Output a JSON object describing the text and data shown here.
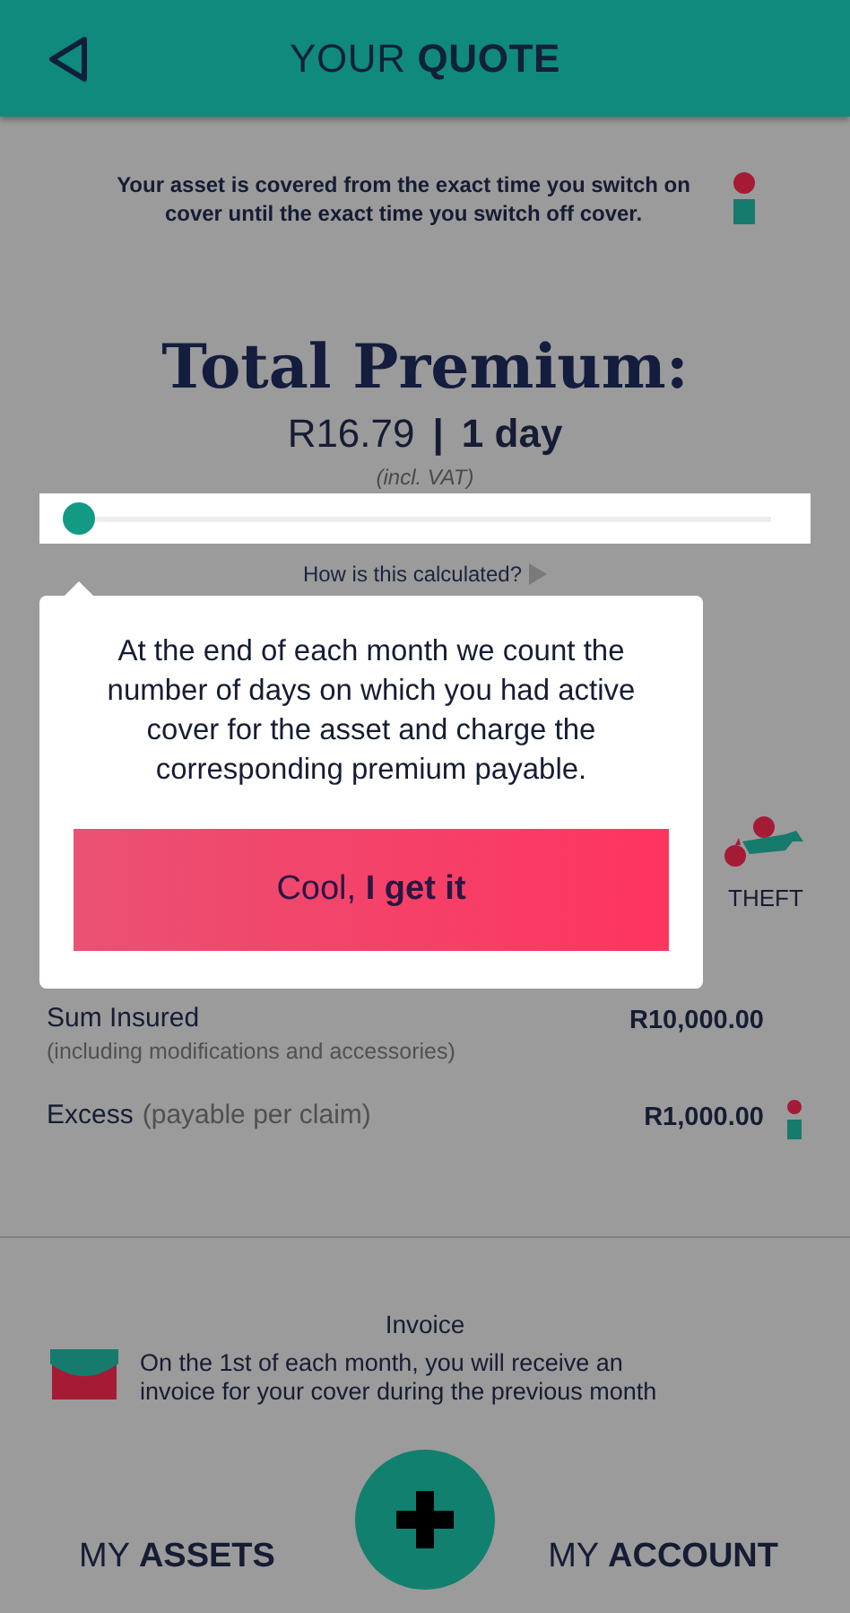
{
  "header": {
    "title": "YOUR **QUOTE**"
  },
  "notice": {
    "text": "Your asset is covered from the exact time you switch on cover until the exact time you switch off cover."
  },
  "premium": {
    "title": "Total Premium:",
    "amount": "R16.79",
    "separator": "|",
    "period": "1 day",
    "vat_note": "(incl. VAT)"
  },
  "slider": {
    "level": 0
  },
  "calc_link": "How is this calculated?",
  "tooltip": {
    "text": "At the end of each month we count the number of days on which you had active cover for the asset and charge the corresponding premium payable.",
    "button": "Cool, **I get it**"
  },
  "covers": [
    {
      "label": "THEFT"
    }
  ],
  "details": [
    {
      "kind": "stacked",
      "label": "Sum Insured",
      "note": "(including modifications and accessories)",
      "value": "R10,000.00",
      "info": false
    },
    {
      "kind": "inline",
      "label": "Excess",
      "note": "(payable per claim)",
      "value": "R1,000.00",
      "info": true
    }
  ],
  "invoice": {
    "title": "Invoice",
    "lines": [
      "On the 1st of each month, you will receive an",
      "invoice for your cover during the previous month"
    ]
  },
  "nav": [
    {
      "label": "MY **ASSETS**"
    },
    {
      "label": "MY **ACCOUNT**"
    }
  ]
}
